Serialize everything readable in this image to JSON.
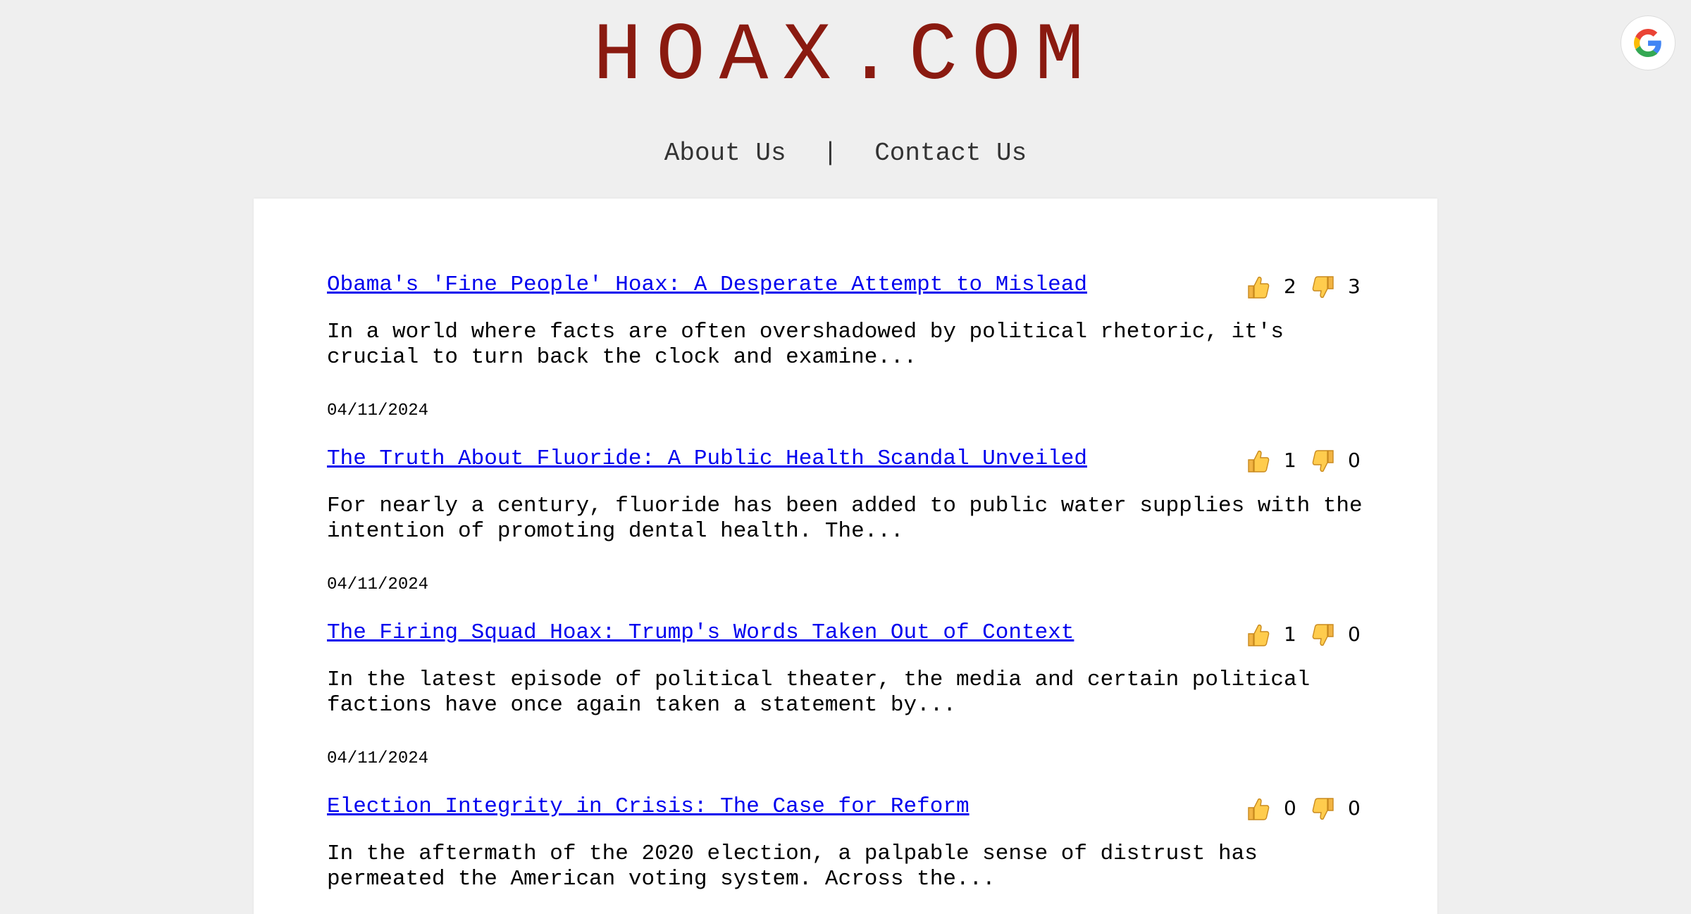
{
  "site": {
    "title": "HOAX.COM",
    "title_color": "#8a1a10",
    "link_color": "#0000ee"
  },
  "nav": {
    "about": "About Us",
    "separator": "|",
    "contact": "Contact Us"
  },
  "google_button": {
    "icon": "google-g-icon"
  },
  "posts": [
    {
      "title": "Obama's 'Fine People' Hoax: A Desperate Attempt to Mislead",
      "excerpt": "In a world where facts are often overshadowed by political rhetoric, it's crucial to turn back the clock and examine...",
      "date": "04/11/2024",
      "likes": "2",
      "dislikes": "3"
    },
    {
      "title": "The Truth About Fluoride: A Public Health Scandal Unveiled",
      "excerpt": "For nearly a century, fluoride has been added to public water supplies with the intention of promoting dental health. The...",
      "date": "04/11/2024",
      "likes": "1",
      "dislikes": "0"
    },
    {
      "title": "The Firing Squad Hoax: Trump's Words Taken Out of Context",
      "excerpt": "In the latest episode of political theater, the media and certain political factions have once again taken a statement by...",
      "date": "04/11/2024",
      "likes": "1",
      "dislikes": "0"
    },
    {
      "title": "Election Integrity in Crisis: The Case for Reform",
      "excerpt": "In the aftermath of the 2020 election, a palpable sense of distrust has permeated the American voting system. Across the...",
      "date": "",
      "likes": "0",
      "dislikes": "0"
    }
  ]
}
